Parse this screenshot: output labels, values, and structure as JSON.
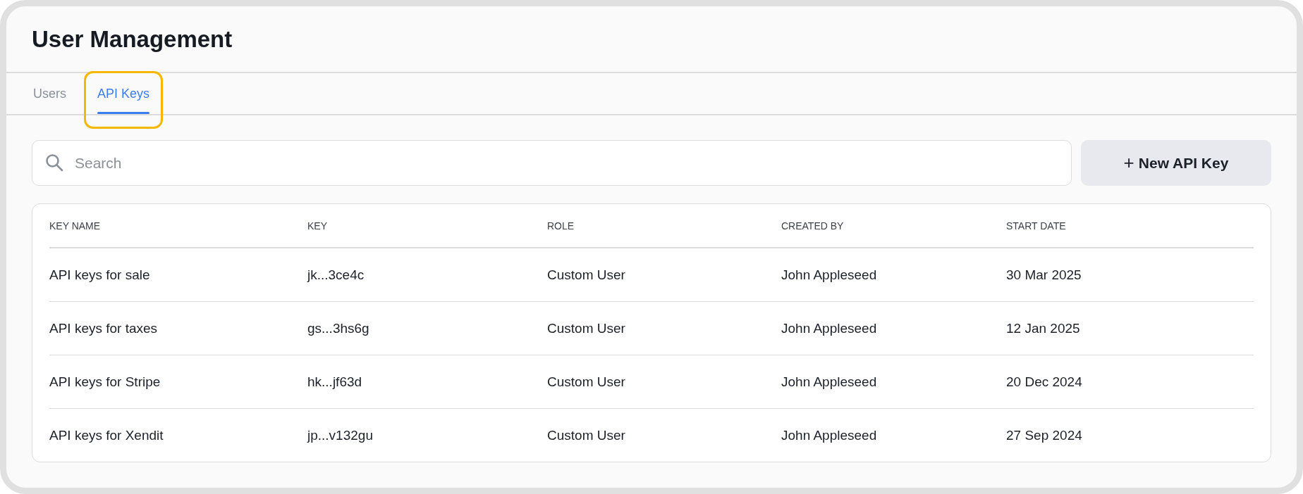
{
  "page": {
    "title": "User Management"
  },
  "tabs": [
    {
      "label": "Users",
      "selected": false,
      "focused": false
    },
    {
      "label": "API Keys",
      "selected": true,
      "focused": true
    }
  ],
  "search": {
    "placeholder": "Search"
  },
  "new_button": {
    "icon": "+",
    "label": "New API Key"
  },
  "table": {
    "columns": [
      "KEY NAME",
      "KEY",
      "ROLE",
      "CREATED BY",
      "START DATE"
    ],
    "rows": [
      [
        "API keys for sale",
        "jk...3ce4c",
        "Custom User",
        "John Appleseed",
        "30 Mar 2025"
      ],
      [
        "API keys for taxes",
        "gs...3hs6g",
        "Custom User",
        "John Appleseed",
        "12 Jan 2025"
      ],
      [
        "API keys for Stripe",
        "hk...jf63d",
        "Custom User",
        "John Appleseed",
        "20 Dec 2024"
      ],
      [
        "API keys for Xendit",
        "jp...v132gu",
        "Custom User",
        "John Appleseed",
        "27 Sep 2024"
      ]
    ]
  }
}
